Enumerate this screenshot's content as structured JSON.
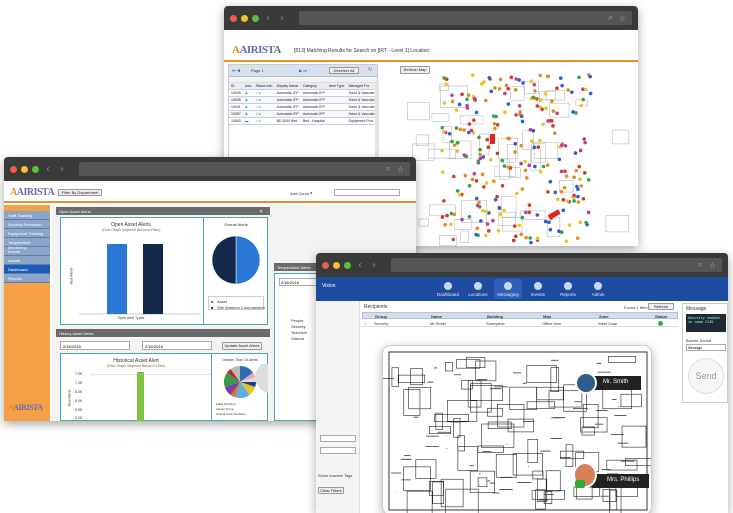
{
  "map_window": {
    "logo": "AIRISTA",
    "results_title": "[813] Matching Results for Search on [IRT - Level 1] Location.",
    "refresh_map": "Refresh Map",
    "deselect_all": "Deselect All",
    "page_text": "Page 1",
    "table_headers": [
      "ID",
      "Icon",
      "Status Info",
      "Display Name",
      "Category",
      "Item Type",
      "Managed For"
    ],
    "rows": [
      [
        "10009",
        "Automatic IFP",
        "Automatic IFP",
        "Hand & Vascular"
      ],
      [
        "10025",
        "Automatic IFP",
        "Automatic IFP",
        "Hand & Vascular"
      ],
      [
        "10031",
        "Automatic IFP",
        "Automatic IFP",
        "Hand & Vascular"
      ],
      [
        "10057",
        "Automatic IFP",
        "Automatic IFP",
        "Hand & Vascular"
      ],
      [
        "10063",
        "BD 3000 Bed",
        "Bed - Hospital",
        "Equipment Pool"
      ]
    ]
  },
  "dashboard_window": {
    "logo": "AIRISTA",
    "filter_button": "Filter By Department",
    "add_count": "Add Count",
    "sidebar": [
      "Staff Tracking",
      "Security Personnel",
      "Equipment Tracking",
      "Temperature Monitoring",
      "Events",
      "Locate",
      "Dashboard",
      "Reports"
    ],
    "open_asset_alerts": {
      "tab": "Open Asset Alerts",
      "title": "Open Asset Alerts",
      "subtitle": "(Click Graph Segment Below to Filter)",
      "ylabel": "New Alerts",
      "xlabel": "Open Alert Types"
    },
    "overall_alerts": {
      "title": "Overall Alerts",
      "legend": [
        "Asset",
        "Site Workers Commanders"
      ]
    },
    "history_tab": "History Asset Alerts",
    "date_from": "2/16/2016",
    "date_to": "2/16/2016",
    "update_button": "Update Asset Alerts",
    "historical": {
      "title": "Historical Asset Alert",
      "subtitle": "(Click Graph Segment Below to Filter)",
      "ylabel": "New Alerts",
      "yticks": [
        "7.5K",
        "7.0K",
        "6.5K",
        "6.0K",
        "5.5K",
        "5.0K"
      ]
    },
    "greater_title": "Greater Than 15 Alerts",
    "greater_legend": [
      "False Duration",
      "Inferior Prone",
      "Critical Care Numbers"
    ],
    "temp_tab": "Temperature Alerts",
    "temp_date": "2/16/2016",
    "temp_legend": [
      "People",
      "Security",
      "Teachers",
      "Visitors"
    ]
  },
  "messaging_window": {
    "brand": "Vision",
    "nav": [
      "Dashboard",
      "Locations",
      "Messaging",
      "Events",
      "Reports",
      "Admin"
    ],
    "recipients_label": "Recipients",
    "found_text": "Found 1 Item",
    "refresh": "Refresh",
    "headers": [
      "Group",
      "Name",
      "Building",
      "Map",
      "Zone",
      "Status"
    ],
    "row": [
      "Security",
      "Mr.Smith",
      "Sunnyside",
      "Office floor",
      "West Zone"
    ],
    "person1": "Mr. Smith",
    "person2": "Mrs. Phillips",
    "message_label": "Message",
    "message_text": "Security needed in room 2145",
    "buzzer_label": "Buzzer Sound",
    "buzzer_value": "Message",
    "send": "Send",
    "show_inactive": "Show Inactive Tags",
    "clear_filters": "Clear Filters"
  },
  "chart_data": [
    {
      "type": "bar",
      "title": "Open Asset Alerts",
      "subtitle": "(Click Graph Segment Below to Filter)",
      "ylabel": "New Alerts",
      "xlabel": "Open Alert Types",
      "series": [
        {
          "name": "Asset",
          "values": [
            1
          ]
        },
        {
          "name": "Site Workers Commanders",
          "values": [
            1
          ]
        }
      ]
    },
    {
      "type": "pie",
      "title": "Overall Alerts",
      "categories": [
        "Asset",
        "Site Workers Commanders"
      ],
      "values": [
        1,
        1
      ]
    }
  ],
  "colors": {
    "blue_bar": "#2b77d6",
    "navy_bar": "#13284a",
    "green_bar": "#7dc241",
    "orange_sidebar": "#f5a047",
    "nav_blue": "#1c4ba0"
  }
}
